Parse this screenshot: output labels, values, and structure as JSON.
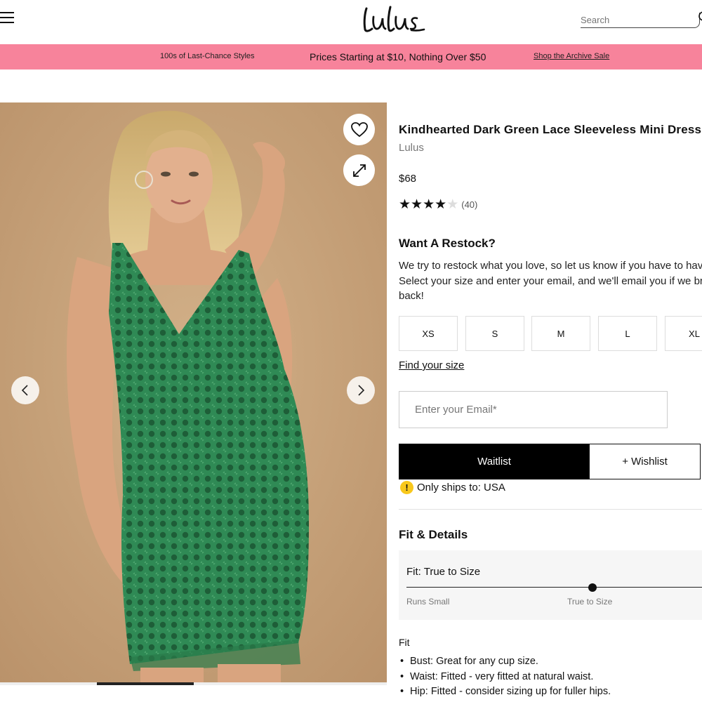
{
  "header": {
    "logo": "Lulus",
    "search_placeholder": "Search"
  },
  "promo": {
    "left": "100s of Last-Chance Styles",
    "center": "Prices Starting at $10, Nothing Over $50",
    "right": "Shop the Archive Sale",
    "bg_color": "#f7839b"
  },
  "product": {
    "title": "Kindhearted Dark Green Lace Sleeveless Mini Dress",
    "brand": "Lulus",
    "price": "$68",
    "rating": 4,
    "rating_max": 5,
    "review_count": "(40)"
  },
  "restock": {
    "title": "Want A Restock?",
    "text": "We try to restock what you love, so let us know if you have to have it! Select your size and enter your email, and we'll email you if we bring it back!",
    "sizes": [
      "XS",
      "S",
      "M",
      "L",
      "XL"
    ],
    "find_size": "Find your size",
    "email_placeholder": "Enter your Email*",
    "waitlist_label": "Waitlist",
    "wishlist_label": "+ Wishlist",
    "ships_text": "Only ships to: USA"
  },
  "fit": {
    "title": "Fit & Details",
    "fit_label": "Fit: True to Size",
    "scale_left": "Runs Small",
    "scale_center": "True to Size",
    "sub_title": "Fit",
    "bullets": [
      "Bust: Great for any cup size.",
      "Waist: Fitted - very fitted at natural waist.",
      "Hip: Fitted - consider sizing up for fuller hips."
    ]
  },
  "gallery": {
    "current_slide": 2,
    "total_slides": 4
  }
}
